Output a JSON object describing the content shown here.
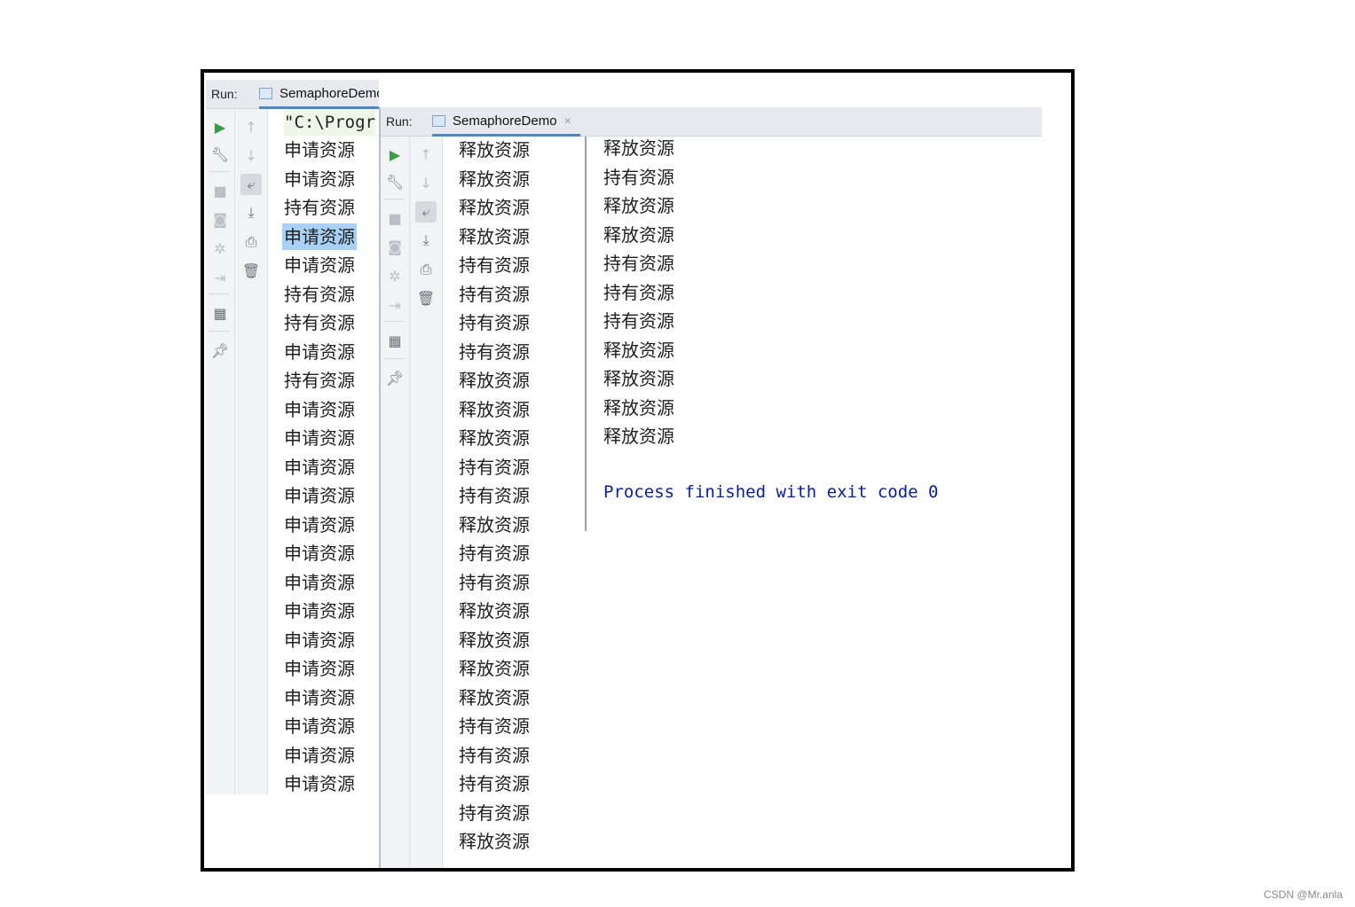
{
  "back_window": {
    "run_label": "Run:",
    "tab_title": "SemaphoreDemo",
    "tab_close": "×",
    "command_line": "\"C:\\Progr",
    "lines": [
      "申请资源",
      "申请资源",
      "持有资源",
      "申请资源",
      "申请资源",
      "持有资源",
      "持有资源",
      "申请资源",
      "持有资源",
      "申请资源",
      "申请资源",
      "申请资源",
      "申请资源",
      "申请资源",
      "申请资源",
      "申请资源",
      "申请资源",
      "申请资源",
      "申请资源",
      "申请资源",
      "申请资源",
      "申请资源",
      "申请资源"
    ],
    "highlighted_line_index": 3
  },
  "front_window": {
    "run_label": "Run:",
    "tab_title": "SemaphoreDemo",
    "tab_close": "×",
    "lines_col1": [
      "释放资源",
      "释放资源",
      "释放资源",
      "释放资源",
      "持有资源",
      "持有资源",
      "持有资源",
      "持有资源",
      "释放资源",
      "释放资源",
      "释放资源",
      "持有资源",
      "持有资源",
      "释放资源",
      "持有资源",
      "持有资源",
      "释放资源",
      "释放资源",
      "释放资源",
      "释放资源",
      "持有资源",
      "持有资源",
      "持有资源",
      "持有资源",
      "释放资源"
    ],
    "lines_col2": [
      "释放资源",
      "持有资源",
      "释放资源",
      "释放资源",
      "持有资源",
      "持有资源",
      "持有资源",
      "释放资源",
      "释放资源",
      "释放资源",
      "释放资源"
    ],
    "process_message": "Process finished with exit code 0"
  },
  "toolbar_icons": [
    "run-icon",
    "wrench-icon",
    "stop-icon",
    "camera-icon",
    "debug-icon",
    "login-icon",
    "layout-icon",
    "pin-icon",
    "up-arrow-icon",
    "down-arrow-icon",
    "soft-wrap-icon",
    "scroll-to-end-icon",
    "print-icon",
    "trash-icon",
    "gear-icon"
  ],
  "colors": {
    "run_green": "#3c9b4a",
    "highlight": "#a8d1f5",
    "tab_underline": "#4a88c7",
    "process_text": "#0a1f8f"
  },
  "watermark": "CSDN @Mr.anla"
}
